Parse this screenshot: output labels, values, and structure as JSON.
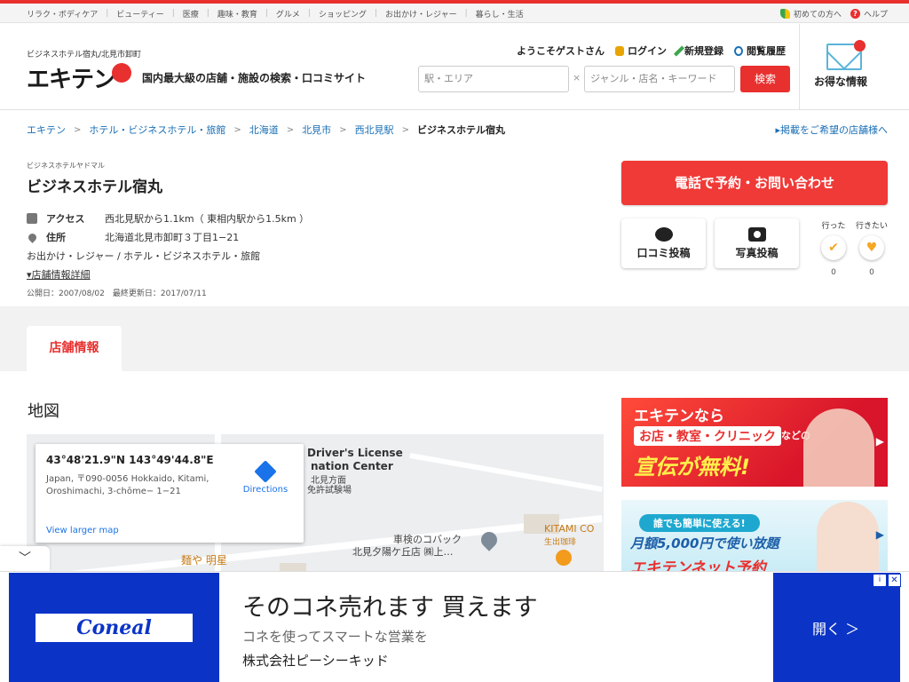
{
  "top_categories": [
    "リラク・ボディケア",
    "ビューティー",
    "医療",
    "趣味・教育",
    "グルメ",
    "ショッピング",
    "お出かけ・レジャー",
    "暮らし・生活"
  ],
  "help_links": {
    "first_time": "初めての方へ",
    "help": "ヘルプ"
  },
  "header": {
    "site_crumb": "ビジネスホテル宿丸/北見市卸町",
    "logo": "エキテン",
    "tagline": "国内最大級の店舗・施設の検索・口コミサイト",
    "welcome": "ようこそゲストさん",
    "login": "ログイン",
    "register": "新規登録",
    "history": "閲覧履歴",
    "area_placeholder": "駅・エリア",
    "x": "×",
    "keyword_placeholder": "ジャンル・店名・キーワード",
    "search_label": "検索",
    "deals_label": "お得な情報"
  },
  "breadcrumb": [
    "エキテン",
    "ホテル・ビジネスホテル・旅館",
    "北海道",
    "北見市",
    "西北見駅",
    "ビジネスホテル宿丸"
  ],
  "owner_link": "掲載をご希望の店舗様へ",
  "shop": {
    "kana": "ビジネスホテルヤドマル",
    "name": "ビジネスホテル宿丸",
    "access_label": "アクセス",
    "access": "西北見駅から1.1km（ 東相内駅から1.5km ）",
    "address_label": "住所",
    "address": "北海道北見市卸町３丁目1−21",
    "categories": "お出かけ・レジャー /  ホテル・ビジネスホテル・旅館",
    "detail_link": "店舗情報詳細",
    "dates": "公開日：2007/08/02　最終更新日：2017/07/11"
  },
  "actions": {
    "call": "電話で予約・お問い合わせ",
    "review": "口コミ投稿",
    "photo": "写真投稿",
    "went_label": "行った",
    "went_count": "0",
    "want_label": "行きたい",
    "want_count": "0"
  },
  "tab": "店舗情報",
  "map": {
    "heading": "地図",
    "coords": "43°48'21.9\"N 143°49'44.8\"E",
    "address": "Japan, 〒090-0056 Hokkaido, Kitami, Oroshimachi, 3-chōme− 1−21",
    "directions": "Directions",
    "larger": "View larger map",
    "labels": {
      "dl1": "Driver's License",
      "dl2": "nation Center",
      "dl3": "北見方面",
      "dl4": "免許試験場",
      "shop1": "車検のコバック",
      "shop2": "北見夕陽ケ丘店 ㈱上…",
      "kitami1": "KITAMI CO",
      "kitami2": "生出珈琲",
      "ramen": "麺や 明星"
    }
  },
  "ads": {
    "ad1": {
      "l1": "エキテンなら",
      "l2": "お店・教室・クリニック",
      "l2s": "などの",
      "l3": "宣伝が無料!"
    },
    "ad2": {
      "l1": "誰でも簡単に使える!",
      "l2": "月額5,000円で使い放題",
      "l3": "エキテンネット予約"
    }
  },
  "bottom_ad": {
    "brand": "Coneal",
    "headline": "そのコネ売れます 買えます",
    "sub": "コネを使ってスマートな営業を",
    "company": "株式会社ピーシーキッド",
    "open": "開く ＞",
    "info": "i",
    "close": "✕"
  }
}
